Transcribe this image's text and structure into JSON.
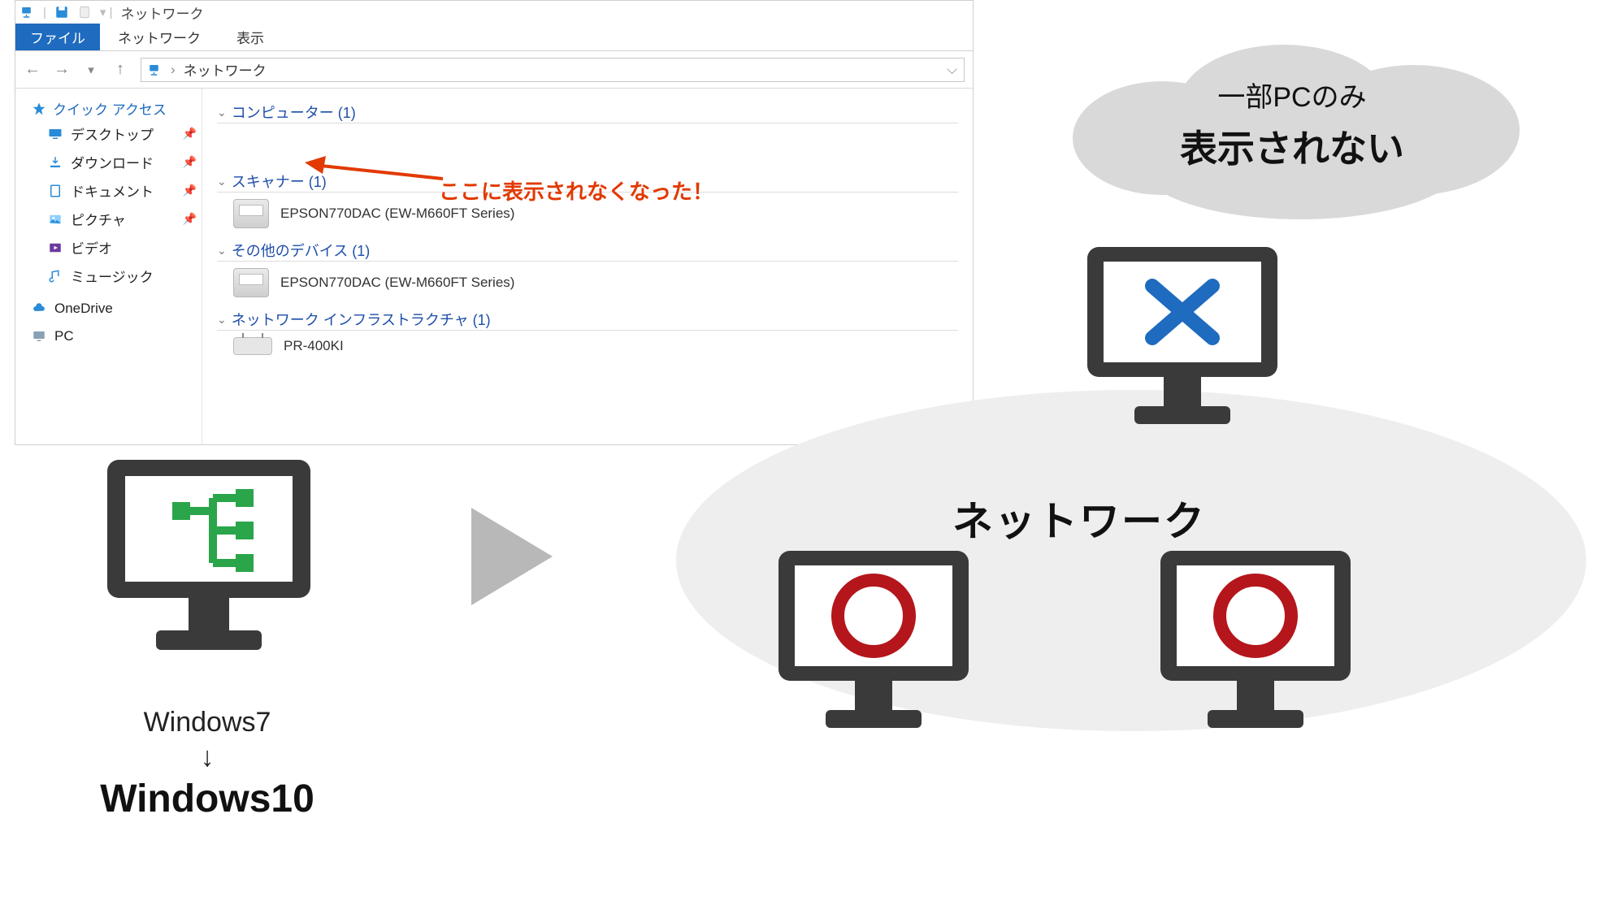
{
  "explorer": {
    "window_title": "ネットワーク",
    "tabs": {
      "file": "ファイル",
      "network": "ネットワーク",
      "view": "表示"
    },
    "address": {
      "location": "ネットワーク"
    },
    "sidebar": {
      "quick_access": "クイック アクセス",
      "items": [
        {
          "label": "デスクトップ"
        },
        {
          "label": "ダウンロード"
        },
        {
          "label": "ドキュメント"
        },
        {
          "label": "ピクチャ"
        },
        {
          "label": "ビデオ"
        },
        {
          "label": "ミュージック"
        }
      ],
      "onedrive": "OneDrive",
      "pc": "PC"
    },
    "groups": [
      {
        "title": "コンピューター (1)",
        "items": []
      },
      {
        "title": "スキャナー (1)",
        "items": [
          {
            "label": "EPSON770DAC (EW-M660FT Series)"
          }
        ]
      },
      {
        "title": "その他のデバイス (1)",
        "items": [
          {
            "label": "EPSON770DAC (EW-M660FT Series)"
          }
        ]
      },
      {
        "title": "ネットワーク インフラストラクチャ (1)",
        "items": [
          {
            "label": "PR-400KI"
          }
        ]
      }
    ]
  },
  "callout_text": "ここに表示されなくなった！",
  "os": {
    "from": "Windows7",
    "arrow": "↓",
    "to": "Windows10"
  },
  "cloud": {
    "line1": "一部PCのみ",
    "line2": "表示されない"
  },
  "network_label": "ネットワーク",
  "marks": {
    "x": "✕",
    "o": "〇"
  },
  "colors": {
    "mark_x": "#1e6bbf",
    "mark_o": "#b4161b",
    "callout": "#e23900",
    "monitor": "#3a3a3a",
    "network_green": "#2aa54a"
  }
}
